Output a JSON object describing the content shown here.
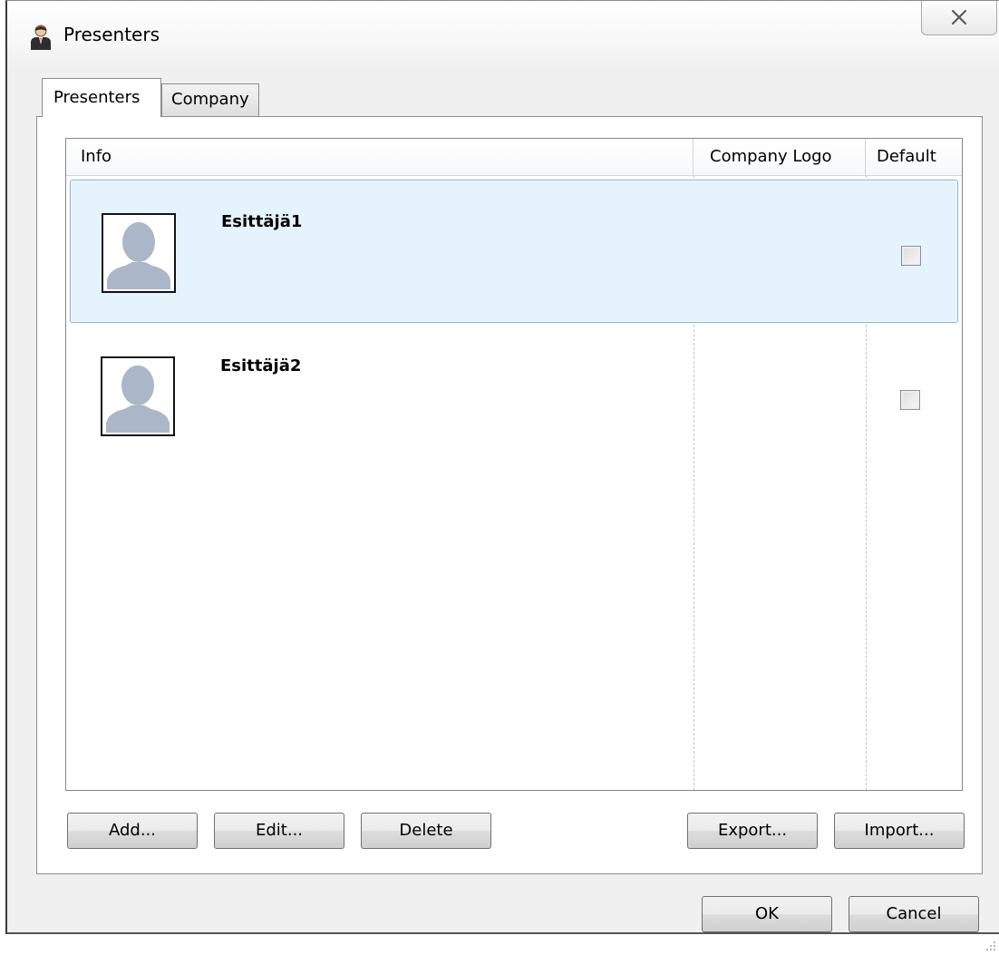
{
  "window": {
    "title": "Presenters",
    "close_glyph": "✕"
  },
  "tabs": [
    {
      "label": "Presenters",
      "active": true
    },
    {
      "label": "Company",
      "active": false
    }
  ],
  "list": {
    "columns": {
      "info": "Info",
      "company_logo": "Company Logo",
      "default": "Default"
    },
    "rows": [
      {
        "name": "Esittäjä1",
        "selected": true,
        "default": false
      },
      {
        "name": "Esittäjä2",
        "selected": false,
        "default": false
      }
    ]
  },
  "actions": {
    "add": "Add...",
    "edit": "Edit...",
    "delete": "Delete",
    "export": "Export...",
    "import": "Import..."
  },
  "dialog": {
    "ok": "OK",
    "cancel": "Cancel"
  },
  "colors": {
    "selection_fill": "#e5f3fd",
    "selection_border": "#7eb4ea",
    "avatar_silhouette": "#a9b7c9"
  },
  "icons": {
    "app": "presenter-icon",
    "close": "close-icon",
    "avatar": "person-placeholder-icon"
  }
}
